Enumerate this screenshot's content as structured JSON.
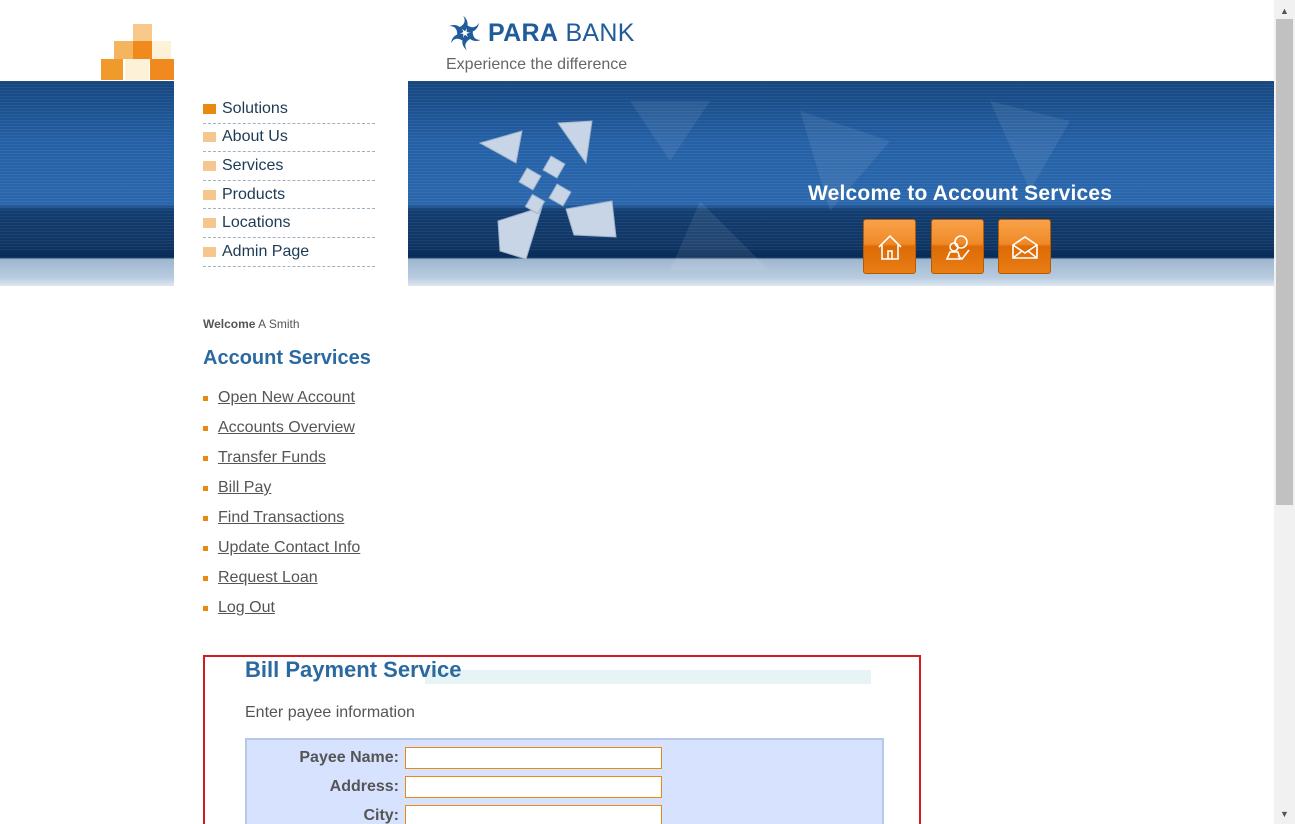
{
  "brand": {
    "name_bold": "PARA",
    "name_light": "BANK",
    "caption": "Experience the difference"
  },
  "header": {
    "title": "Welcome to Account Services",
    "buttons": [
      {
        "icon": "home-icon",
        "label": "home"
      },
      {
        "icon": "about-icon",
        "label": "about"
      },
      {
        "icon": "contact-icon",
        "label": "contact"
      }
    ]
  },
  "main_nav": {
    "items": [
      {
        "label": "Solutions",
        "active": true
      },
      {
        "label": "About Us"
      },
      {
        "label": "Services"
      },
      {
        "label": "Products"
      },
      {
        "label": "Locations"
      },
      {
        "label": "Admin Page"
      }
    ]
  },
  "welcome": {
    "label": "Welcome",
    "user": "A Smith"
  },
  "account_services": {
    "title": "Account Services",
    "links": [
      "Open New Account",
      "Accounts Overview",
      "Transfer Funds",
      "Bill Pay",
      "Find Transactions",
      "Update Contact Info",
      "Request Loan",
      "Log Out"
    ]
  },
  "bill_pay": {
    "title": "Bill Payment Service",
    "subtitle": "Enter payee information",
    "fields": [
      {
        "label": "Payee Name:",
        "value": ""
      },
      {
        "label": "Address:",
        "value": ""
      },
      {
        "label": "City:",
        "value": ""
      }
    ]
  },
  "colors": {
    "brand_blue": "#1f5c99",
    "heading_blue": "#2a6aa0",
    "accent_orange": "#e88a12",
    "highlight_red": "#d11a22",
    "form_bg": "#d7e3fe"
  }
}
